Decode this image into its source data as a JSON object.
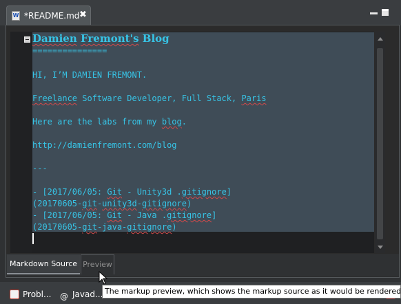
{
  "editor_tab": {
    "title": "*README.md",
    "icon": "markdown-file-icon",
    "close_label": "✖"
  },
  "window_controls": {
    "minimize_icon": "minimize-icon",
    "maximize_icon": "maximize-icon"
  },
  "document": {
    "lines": [
      "Damien Fremont's Blog",
      "===============",
      "",
      "HI, I’M DAMIEN FREMONT.",
      "",
      "Freelance Software Developer, Full Stack, Paris",
      "",
      "Here are the labs from my blog.",
      "",
      "http://damienfremont.com/blog",
      "",
      "---",
      "",
      "- [2017/06/05: Git - Unity3d .gitignore]",
      "(20170605-git-unity3d-gitignore)",
      "- [2017/06/05: Git - Java .gitignore]",
      "(20170605-git-java-gitignore)"
    ]
  },
  "bottom_tabs": {
    "markdown_source": "Markdown Source",
    "preview": "Preview"
  },
  "taskbar": {
    "problems": "Probl...",
    "javadoc": "Javad..."
  },
  "tooltip": {
    "text": "The markup preview, which shows the markup source as it would be rendered to H"
  },
  "colors": {
    "text": "#37c4e6",
    "selection": "#3f4c57",
    "editor_background": "#1f2022",
    "chrome": "#3a3d40"
  }
}
